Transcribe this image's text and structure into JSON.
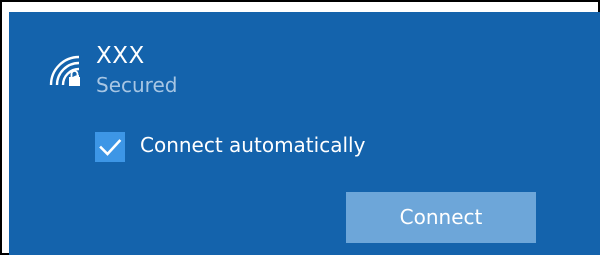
{
  "network": {
    "name": "XXX",
    "status": "Secured",
    "icon": "wifi-secured-icon"
  },
  "options": {
    "connect_automatically_label": "Connect automatically",
    "connect_automatically_checked": true,
    "check_icon": "checkmark-icon"
  },
  "actions": {
    "connect_label": "Connect"
  },
  "colors": {
    "panel_background": "#1463ac",
    "checkbox_fill": "#3d96e6",
    "button_fill": "#6da6d9",
    "secondary_text": "#a7c6e4"
  }
}
